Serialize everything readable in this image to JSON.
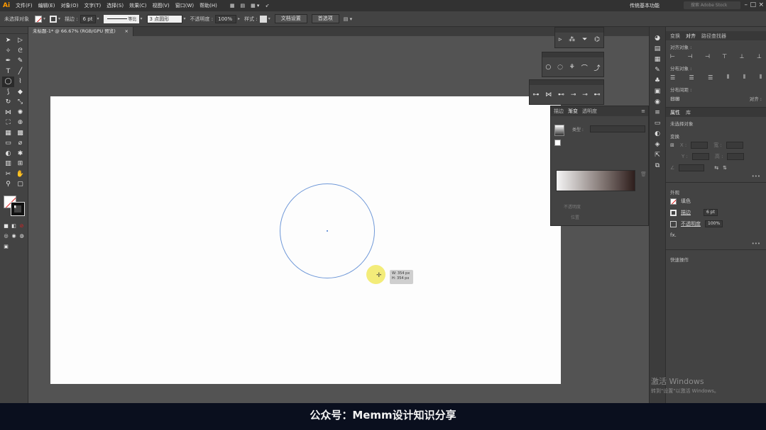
{
  "menubar": {
    "logo": "Ai",
    "items": [
      "文件(F)",
      "编辑(E)",
      "对象(O)",
      "文字(T)",
      "选择(S)",
      "效果(C)",
      "视图(V)",
      "窗口(W)",
      "帮助(H)"
    ],
    "workspace": "传统基本功能",
    "search_placeholder": "搜索 Adobe Stock"
  },
  "controlbar": {
    "no_selection": "未选择对象",
    "stroke_label": "描边 :",
    "stroke_weight": "6 pt",
    "profile_label": "等比",
    "brush_label": "3 点圆形",
    "opacity_label": "不透明度 :",
    "opacity_value": "100%",
    "style_label": "样式 :",
    "doc_setup": "文档设置",
    "preferences": "首选项"
  },
  "document": {
    "tab_title": "未标题-1* @ 66.67% (RGB/GPU 预览)",
    "close": "×"
  },
  "tooltip": {
    "width": "W: 354 px",
    "height": "H: 354 px"
  },
  "gradient_panel": {
    "tabs": [
      "描边",
      "渐变",
      "透明度"
    ],
    "type_label": "类型 :",
    "row1": "不透明度",
    "row2": "位置"
  },
  "right_panel": {
    "tabs": [
      "变换",
      "对齐",
      "路径查找器"
    ],
    "align_objects": "对齐对象 :",
    "distribute_objects": "分布对象 :",
    "distribute_spacing": "分布间距 :",
    "align_to": "对齐 :",
    "props_tabs": [
      "属性",
      "库"
    ],
    "no_selection": "未选择对象",
    "transform": "变换",
    "x_label": "X :",
    "y_label": "Y :",
    "w_label": "宽 :",
    "h_label": "高 :",
    "appearance": "外观",
    "fill_label": "填色",
    "stroke_label": "描边",
    "stroke_value": "6 pt",
    "opacity_label": "不透明度",
    "opacity_value": "100%",
    "fx": "fx.",
    "quick_actions": "快速操作"
  },
  "watermark": {
    "line1": "激活 Windows",
    "line2": "转到\"设置\"以激活 Windows。"
  },
  "caption": "公众号：Memm设计知识分享",
  "icons": {
    "tools": [
      "selection-icon",
      "direct-selection-icon",
      "magic-wand-icon",
      "lasso-icon",
      "pen-icon",
      "curvature-icon",
      "type-icon",
      "line-icon",
      "ellipse-icon",
      "paintbrush-icon",
      "shaper-icon",
      "eraser-icon",
      "rotate-icon",
      "scale-icon",
      "width-icon",
      "warp-icon",
      "free-transform-icon",
      "shape-builder-icon",
      "perspective-icon",
      "mesh-icon",
      "gradient-icon",
      "eyedropper-icon",
      "blend-icon",
      "symbol-sprayer-icon",
      "column-graph-icon",
      "artboard-icon",
      "slice-icon",
      "hand-icon",
      "zoom-icon"
    ],
    "colors": {
      "stroke_circle": "#6f98d8",
      "artboard": "#fdfdfd",
      "pasteboard": "#535353",
      "caption_bg": "#0a0f1e",
      "cursor_highlight": "#f2ea6a"
    }
  }
}
